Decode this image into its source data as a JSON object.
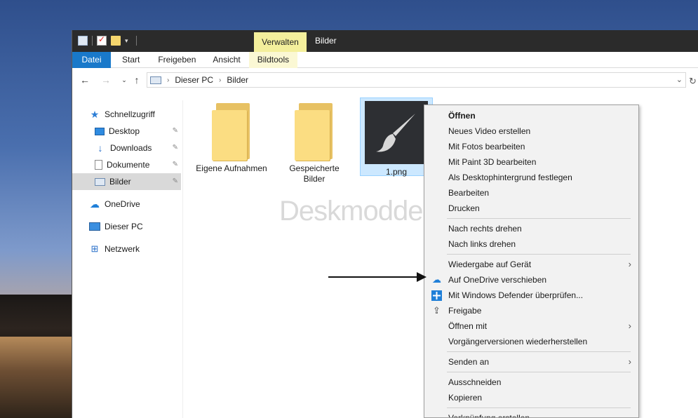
{
  "window": {
    "title": "Bilder",
    "contextual_tab_header": "Verwalten"
  },
  "ribbon": {
    "tabs": [
      {
        "label": "Datei"
      },
      {
        "label": "Start"
      },
      {
        "label": "Freigeben"
      },
      {
        "label": "Ansicht"
      },
      {
        "label": "Bildtools"
      }
    ]
  },
  "address": {
    "crumbs": [
      "Dieser PC",
      "Bilder"
    ]
  },
  "nav": {
    "items": [
      {
        "label": "Schnellzugriff",
        "icon": "star-icon"
      },
      {
        "label": "Desktop",
        "icon": "desktop-icon"
      },
      {
        "label": "Downloads",
        "icon": "download-icon"
      },
      {
        "label": "Dokumente",
        "icon": "document-icon"
      },
      {
        "label": "Bilder",
        "icon": "pictures-icon"
      },
      {
        "label": "OneDrive",
        "icon": "cloud-icon"
      },
      {
        "label": "Dieser PC",
        "icon": "pc-icon"
      },
      {
        "label": "Netzwerk",
        "icon": "network-icon"
      }
    ]
  },
  "files": [
    {
      "label": "Eigene Aufnahmen",
      "type": "folder"
    },
    {
      "label": "Gespeicherte Bilder",
      "type": "folder"
    },
    {
      "label": "1.png",
      "type": "image"
    }
  ],
  "watermark": "Deskmodder.de",
  "context_menu": {
    "items": [
      {
        "label": "Öffnen"
      },
      {
        "label": "Neues Video erstellen"
      },
      {
        "label": "Mit Fotos bearbeiten"
      },
      {
        "label": "Mit Paint 3D bearbeiten"
      },
      {
        "label": "Als Desktophintergrund festlegen"
      },
      {
        "label": "Bearbeiten"
      },
      {
        "label": "Drucken"
      },
      {
        "label": "Nach rechts drehen"
      },
      {
        "label": "Nach links drehen"
      },
      {
        "label": "Wiedergabe auf Gerät"
      },
      {
        "label": "Auf OneDrive verschieben",
        "icon": "cloud-icon"
      },
      {
        "label": "Mit Windows Defender überprüfen...",
        "icon": "shield-icon"
      },
      {
        "label": "Freigabe",
        "icon": "share-icon"
      },
      {
        "label": "Öffnen mit"
      },
      {
        "label": "Vorgängerversionen wiederherstellen"
      },
      {
        "label": "Senden an"
      },
      {
        "label": "Ausschneiden"
      },
      {
        "label": "Kopieren"
      },
      {
        "label": "Verknüpfung erstellen"
      }
    ]
  },
  "colors": {
    "file_tab": "#1979ca",
    "contextual_tab": "#f4ef9c",
    "selection": "#cce8ff"
  }
}
